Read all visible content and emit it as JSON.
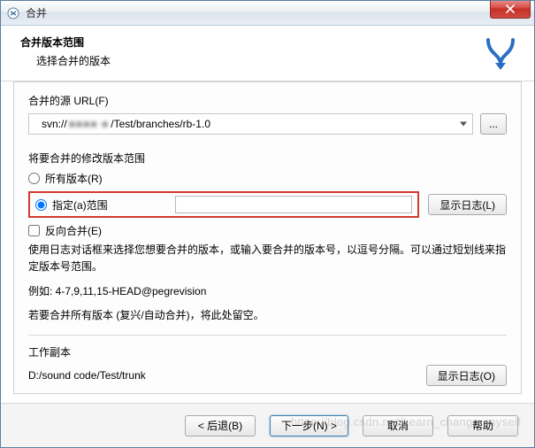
{
  "window": {
    "title": "合并",
    "close_icon": "close-icon"
  },
  "header": {
    "title": "合并版本范围",
    "subtitle": "选择合并的版本"
  },
  "source": {
    "label": "合并的源 URL(F)",
    "url_prefix": "svn://",
    "url_blur": "■■■■ ■",
    "url_suffix": "/Test/branches/rb-1.0",
    "browse_label": "..."
  },
  "revisions": {
    "section_label": "将要合并的修改版本范围",
    "all_label": "所有版本(R)",
    "specific_label": "指定(a)范围",
    "selected": "specific",
    "range_value": "",
    "show_log1_label": "显示日志(L)",
    "reverse_label": "反向合并(E)",
    "reverse_checked": false,
    "help_text": "使用日志对话框来选择您想要合并的版本，或输入要合并的版本号，以逗号分隔。可以通过短划线来指定版本号范围。",
    "example_text": "例如: 4-7,9,11,15-HEAD@pegrevision",
    "note_text": "若要合并所有版本 (复兴/自动合并)，将此处留空。"
  },
  "working_copy": {
    "label": "工作副本",
    "path": "D:/sound code/Test/trunk",
    "show_log2_label": "显示日志(O)"
  },
  "footer": {
    "back_label": "< 后退(B)",
    "next_label": "下一步(N) >",
    "cancel_label": "取消",
    "help_label": "帮助"
  },
  "watermark": "https://blog.csdn.net/Learn_change_myself"
}
